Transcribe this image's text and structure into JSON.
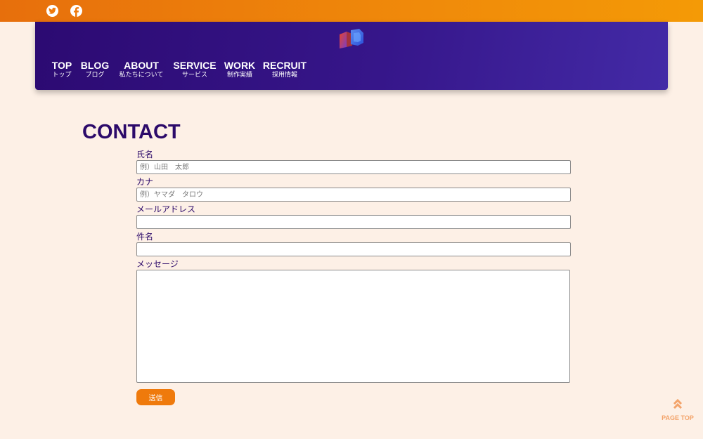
{
  "social": {
    "icons": [
      "twitter-icon",
      "facebook-icon"
    ]
  },
  "nav": {
    "items": [
      {
        "en": "TOP",
        "ja": "トップ"
      },
      {
        "en": "BLOG",
        "ja": "ブログ"
      },
      {
        "en": "ABOUT",
        "ja": "私たちについて"
      },
      {
        "en": "SERVICE",
        "ja": "サービス"
      },
      {
        "en": "WORK",
        "ja": "制作実績"
      },
      {
        "en": "RECRUIT",
        "ja": "採用情報"
      }
    ]
  },
  "page": {
    "title": "CONTACT"
  },
  "form": {
    "name_label": "氏名",
    "name_placeholder": "例）山田　太郎",
    "kana_label": "カナ",
    "kana_placeholder": "例）ヤマダ　タロウ",
    "email_label": "メールアドレス",
    "email_placeholder": "",
    "subject_label": "件名",
    "subject_placeholder": "",
    "message_label": "メッセージ",
    "submit_label": "送信"
  },
  "page_top": {
    "label": "PAGE TOP"
  },
  "colors": {
    "topbar_orange": "#ef7a0c",
    "header_purple": "#2c0a72",
    "title_purple": "#2c0a6a",
    "background": "#fdf0e6",
    "page_top": "#f3a36a"
  }
}
